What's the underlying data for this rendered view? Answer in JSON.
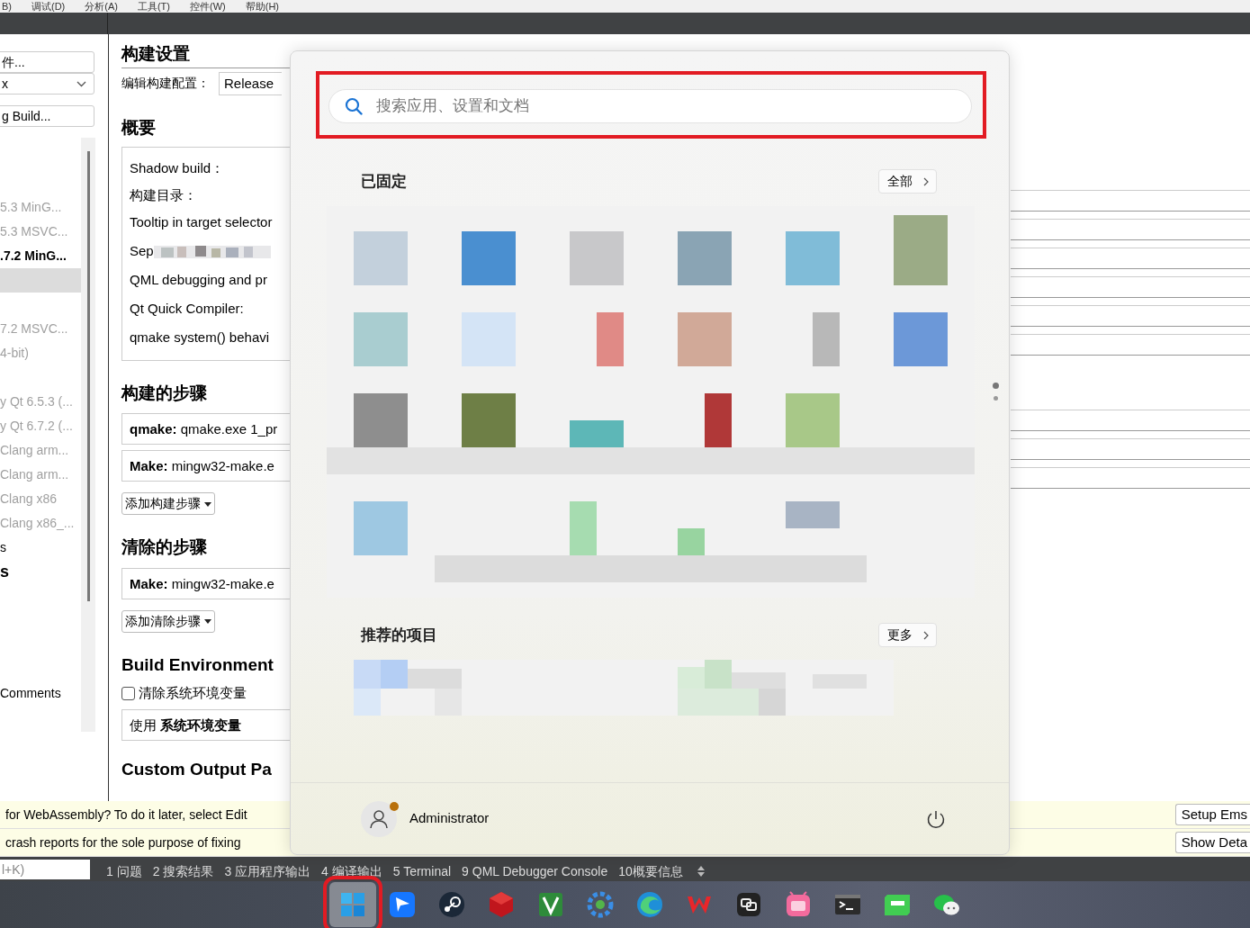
{
  "menu_bar": [
    "B)",
    "调试(D)",
    "分析(A)",
    "工具(T)",
    "控件(W)",
    "帮助(H)"
  ],
  "kit_panel": {
    "file_button": "件...",
    "kit_select": "x",
    "build_button": "g Build...",
    "items": [
      {
        "kind": "disabled",
        "text": "5.3 MinG..."
      },
      {
        "kind": "disabled",
        "text": "5.3 MSVC..."
      },
      {
        "kind": "current",
        "text": ".7.2 MinG..."
      },
      {
        "kind": "highlight"
      },
      {
        "kind": "blank"
      },
      {
        "kind": "disabled",
        "text": "7.2 MSVC..."
      },
      {
        "kind": "disabled",
        "text": "4-bit)"
      },
      {
        "kind": "blank"
      },
      {
        "kind": "disabled",
        "text": "y Qt 6.5.3 (..."
      },
      {
        "kind": "disabled",
        "text": "y Qt 6.7.2 (..."
      },
      {
        "kind": "disabled",
        "text": "Clang arm..."
      },
      {
        "kind": "disabled",
        "text": "Clang arm..."
      },
      {
        "kind": "disabled",
        "text": "Clang x86"
      },
      {
        "kind": "disabled",
        "text": "Clang x86_..."
      },
      {
        "kind": "normal",
        "text": "s"
      },
      {
        "kind": "heading",
        "text": "s"
      },
      {
        "kind": "blank"
      },
      {
        "kind": "blank"
      },
      {
        "kind": "blank"
      },
      {
        "kind": "blank"
      },
      {
        "kind": "normal",
        "text": "Comments"
      }
    ]
  },
  "build_settings": {
    "title": "构建设置",
    "config_label": "编辑构建配置：",
    "config_value": "Release",
    "summary": {
      "title": "概要",
      "rows": [
        {
          "kind": "text",
          "text": "Shadow build："
        },
        {
          "kind": "text",
          "text": "构建目录："
        },
        {
          "kind": "text",
          "text": "Tooltip in target selector"
        },
        {
          "kind": "redacted",
          "text": "Sep"
        },
        {
          "kind": "text",
          "text": "QML debugging and pr"
        },
        {
          "kind": "text",
          "text": "Qt Quick Compiler:"
        },
        {
          "kind": "text",
          "text": "qmake system() behavi"
        }
      ]
    },
    "build_steps": {
      "title": "构建的步骤",
      "steps": [
        "**qmake:** qmake.exe 1_pr",
        "**Make:** mingw32-make.e"
      ],
      "add_button": "添加构建步骤"
    },
    "clean_steps": {
      "title": "清除的步骤",
      "steps": [
        "**Make:** mingw32-make.e"
      ],
      "add_button": "添加清除步骤"
    },
    "environment": {
      "title": "Build Environment",
      "clear_checkbox": {
        "label": "清除系统环境变量",
        "checked": false
      },
      "usage": "使用 **系统环境变量**"
    },
    "custom_output": {
      "title": "Custom Output Pa"
    }
  },
  "info_bars": [
    {
      "text": "for WebAssembly? To do it later, select Edit",
      "button": "Setup Ems"
    },
    {
      "text": "crash reports for the sole purpose of fixing",
      "button": "Show Deta"
    }
  ],
  "output_pane": {
    "search": {
      "placeholder": "l+K)"
    },
    "tabs": [
      "1 问题",
      "2 搜索结果",
      "3 应用程序输出",
      "4 编译输出",
      "5 Terminal",
      "9 QML Debugger Console",
      "10概要信息"
    ]
  },
  "start_menu": {
    "search": {
      "placeholder": "搜索应用、设置和文档",
      "highlighted": true
    },
    "pinned": {
      "title": "已固定",
      "more_button": "全部"
    },
    "page_dots": [
      {
        "selected": true
      },
      {
        "selected": false
      }
    ],
    "recommended": {
      "title": "推荐的项目",
      "more_button": "更多"
    },
    "user": {
      "name": "Administrator",
      "notification": true
    }
  },
  "taskbar": {
    "items": [
      {
        "kind": "windows",
        "selected": true
      },
      {
        "kind": "bird",
        "selected": false
      },
      {
        "kind": "steam",
        "selected": false
      },
      {
        "kind": "cube",
        "selected": false
      },
      {
        "kind": "vmark",
        "selected": false
      },
      {
        "kind": "gear",
        "selected": false
      },
      {
        "kind": "edge",
        "selected": false
      },
      {
        "kind": "wmark",
        "selected": false
      },
      {
        "kind": "squares",
        "selected": false
      },
      {
        "kind": "tv",
        "selected": false
      },
      {
        "kind": "terminal",
        "selected": false
      },
      {
        "kind": "qc",
        "selected": false
      },
      {
        "kind": "chat",
        "selected": false
      }
    ]
  }
}
